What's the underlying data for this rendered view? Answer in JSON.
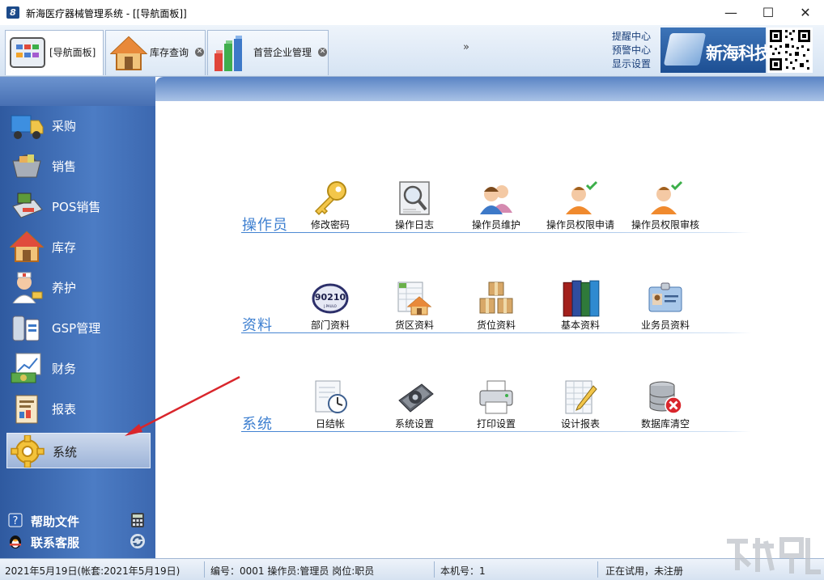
{
  "window": {
    "title": "新海医疗器械管理系统 - [[导航面板]]",
    "app_icon_glyph": "8",
    "minimize": "—",
    "maximize": "☐",
    "close": "✕"
  },
  "tabs": [
    {
      "label": "[导航面板]",
      "icon": "navigation-panel-icon"
    },
    {
      "label": "库存查询",
      "icon": "house-icon"
    },
    {
      "label": "首营企业管理",
      "icon": "bar-chart-3d-icon"
    }
  ],
  "tab_close_glyph": "✕",
  "tab_overflow": "»",
  "header_links": [
    "提醒中心",
    "预警中心",
    "显示设置"
  ],
  "brand": {
    "name": "新海科技",
    "logo_glyph": "8",
    "color": "#1d4f93"
  },
  "sidebar": {
    "items": [
      {
        "label": "采购",
        "icon": "truck-icon"
      },
      {
        "label": "销售",
        "icon": "shopping-basket-icon"
      },
      {
        "label": "POS销售",
        "icon": "pos-terminal-icon"
      },
      {
        "label": "库存",
        "icon": "house-icon"
      },
      {
        "label": "养护",
        "icon": "nurse-icon"
      },
      {
        "label": "GSP管理",
        "icon": "medicine-icon"
      },
      {
        "label": "财务",
        "icon": "money-chart-icon"
      },
      {
        "label": "报表",
        "icon": "report-icon"
      },
      {
        "label": "系统",
        "icon": "gear-icon",
        "active": true
      }
    ],
    "bottom": [
      {
        "label": "帮助文件",
        "icon": "help-icon",
        "tool": "calculator-icon"
      },
      {
        "label": "联系客服",
        "icon": "qq-penguin-icon",
        "tool": "refresh-icon"
      }
    ]
  },
  "sections": [
    {
      "title": "操作员",
      "actions": [
        {
          "label": "修改密码",
          "icon": "key-icon"
        },
        {
          "label": "操作日志",
          "icon": "log-search-icon"
        },
        {
          "label": "操作员维护",
          "icon": "users-icon"
        },
        {
          "label": "操作员权限申请",
          "icon": "user-check-icon"
        },
        {
          "label": "操作员权限审核",
          "icon": "user-check-icon"
        }
      ]
    },
    {
      "title": "资料",
      "actions": [
        {
          "label": "部门资料",
          "icon": "department-stamp-icon",
          "stamp_text": "90210",
          "stamp_sub": "J.PAULO"
        },
        {
          "label": "货区资料",
          "icon": "warehouse-area-icon"
        },
        {
          "label": "货位资料",
          "icon": "boxes-icon"
        },
        {
          "label": "基本资料",
          "icon": "books-icon"
        },
        {
          "label": "业务员资料",
          "icon": "id-card-icon"
        }
      ]
    },
    {
      "title": "系统",
      "actions": [
        {
          "label": "日结帐",
          "icon": "daily-clock-icon"
        },
        {
          "label": "系统设置",
          "icon": "system-settings-icon"
        },
        {
          "label": "打印设置",
          "icon": "printer-icon"
        },
        {
          "label": "设计报表",
          "icon": "design-report-icon"
        },
        {
          "label": "数据库清空",
          "icon": "database-clear-icon"
        }
      ]
    }
  ],
  "status": {
    "date": "2021年5月19日(帐套:2021年5月19日)",
    "operator": "编号：0001 操作员:管理员 岗位:职员",
    "machine": "本机号：1",
    "trial": "正在试用，未注册"
  },
  "colors": {
    "sidebar": "#3c68b0",
    "accent": "#3d7fd0",
    "arrow": "#d9262c"
  }
}
